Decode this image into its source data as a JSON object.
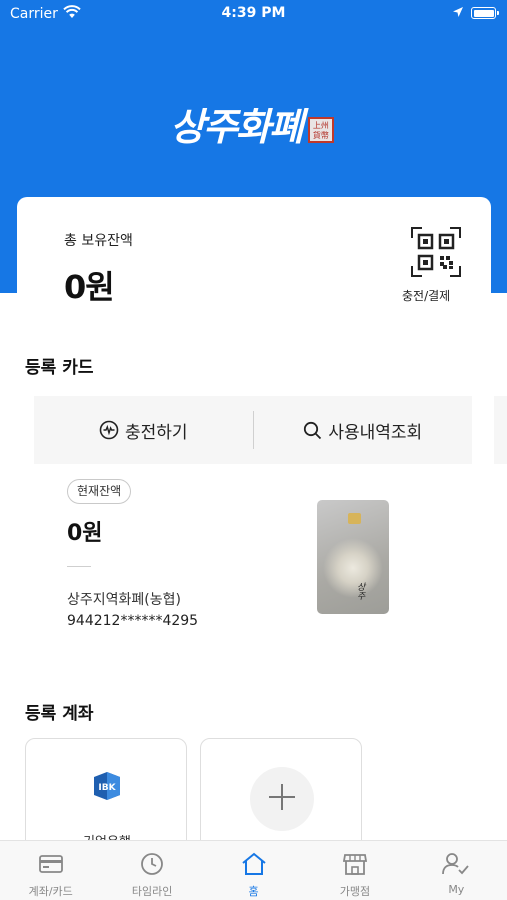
{
  "status_bar": {
    "carrier": "Carrier",
    "time": "4:39 PM"
  },
  "logo": {
    "text": "상주화폐",
    "seal_text": "上州貨幣"
  },
  "balance": {
    "label": "총 보유잔액",
    "amount": "0원",
    "qr_label": "충전/결제"
  },
  "cards_section": {
    "title": "등록 카드",
    "actions": [
      {
        "label": "충전하기",
        "icon": "charge-icon"
      },
      {
        "label": "사용내역조회",
        "icon": "search-icon"
      }
    ],
    "card": {
      "badge": "현재잔액",
      "amount": "0원",
      "name": "상주지역화폐(농협)",
      "number": "944212******4295"
    }
  },
  "accounts_section": {
    "title": "등록 계좌",
    "accounts": [
      {
        "name": "기업은행",
        "icon": "ibk-logo-icon"
      }
    ],
    "add_icon": "plus-icon"
  },
  "tab_bar": {
    "tabs": [
      {
        "label": "계좌/카드",
        "icon": "card-icon"
      },
      {
        "label": "타임라인",
        "icon": "clock-icon"
      },
      {
        "label": "홈",
        "icon": "home-icon",
        "active": true
      },
      {
        "label": "가맹점",
        "icon": "store-icon"
      },
      {
        "label": "My",
        "icon": "user-icon"
      }
    ]
  },
  "colors": {
    "brand": "#1677e5",
    "active_tab": "#1677e5"
  }
}
